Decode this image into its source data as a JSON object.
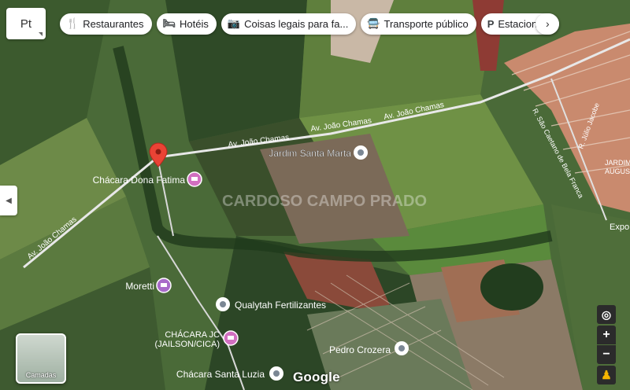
{
  "toolbar": {
    "maptype_label": "Pt",
    "chips": [
      {
        "icon": "fork-knife-icon",
        "glyph": "🍴",
        "label": "Restaurantes"
      },
      {
        "icon": "bed-icon",
        "glyph": "🛏",
        "label": "Hotéis"
      },
      {
        "icon": "camera-icon",
        "glyph": "📷",
        "label": "Coisas legais para fa..."
      },
      {
        "icon": "bus-icon",
        "glyph": "🚍",
        "label": "Transporte público"
      },
      {
        "icon": "parking-icon",
        "glyph": "P",
        "label": "Estacionam"
      }
    ],
    "next_label": "›"
  },
  "map": {
    "roads": [
      {
        "name": "Av. João Chamas",
        "label": "Av. João Chamas"
      },
      {
        "name": "Av. João Chamas 2",
        "label": "Av. João Chamas"
      },
      {
        "name": "Av. João Chamas 3",
        "label": "Av. João Chamas"
      },
      {
        "name": "Av. João Chamas 4",
        "label": "Av. João Chamas"
      },
      {
        "name": "R. São Caetano",
        "label": "R. São Caetano de Bela Franca"
      },
      {
        "name": "R. Júlio Jacob",
        "label": "R. Júlio Jacobe"
      }
    ],
    "places": [
      {
        "label": "Jardim Santa Marta",
        "kind": "place"
      },
      {
        "label": "Chácara Dona Fatima",
        "kind": "lodging"
      },
      {
        "label": "Moretti",
        "kind": "lodging"
      },
      {
        "label": "Qualytah Fertilizantes",
        "kind": "place"
      },
      {
        "label": "CHÁCARA JC",
        "kind": "lodging"
      },
      {
        "label": "(JAILSON/CICA)",
        "kind": "lodging"
      },
      {
        "label": "Pedro Crozera",
        "kind": "place"
      },
      {
        "label": "Chácara Santa Luzia",
        "kind": "place"
      }
    ],
    "edge_labels": [
      "JARDIM",
      "AUGUS",
      "Expo"
    ],
    "watermark": "CARDOSO CAMPO PRADO",
    "colors": {
      "field_dark": "#2f4a27",
      "field_mid": "#4e6b3a",
      "field_light": "#7f9a55",
      "soil_red": "#8a4a3a",
      "urban": "#c98a6e",
      "pin_red": "#ea4335",
      "lodging_pink": "#d16fc0"
    }
  },
  "controls": {
    "layers_label": "Camadas",
    "side_tab_glyph": "◀",
    "locate_glyph": "◎",
    "zoom_in": "+",
    "zoom_out": "−",
    "pegman_glyph": "♟"
  },
  "attribution": {
    "logo": "Google"
  }
}
